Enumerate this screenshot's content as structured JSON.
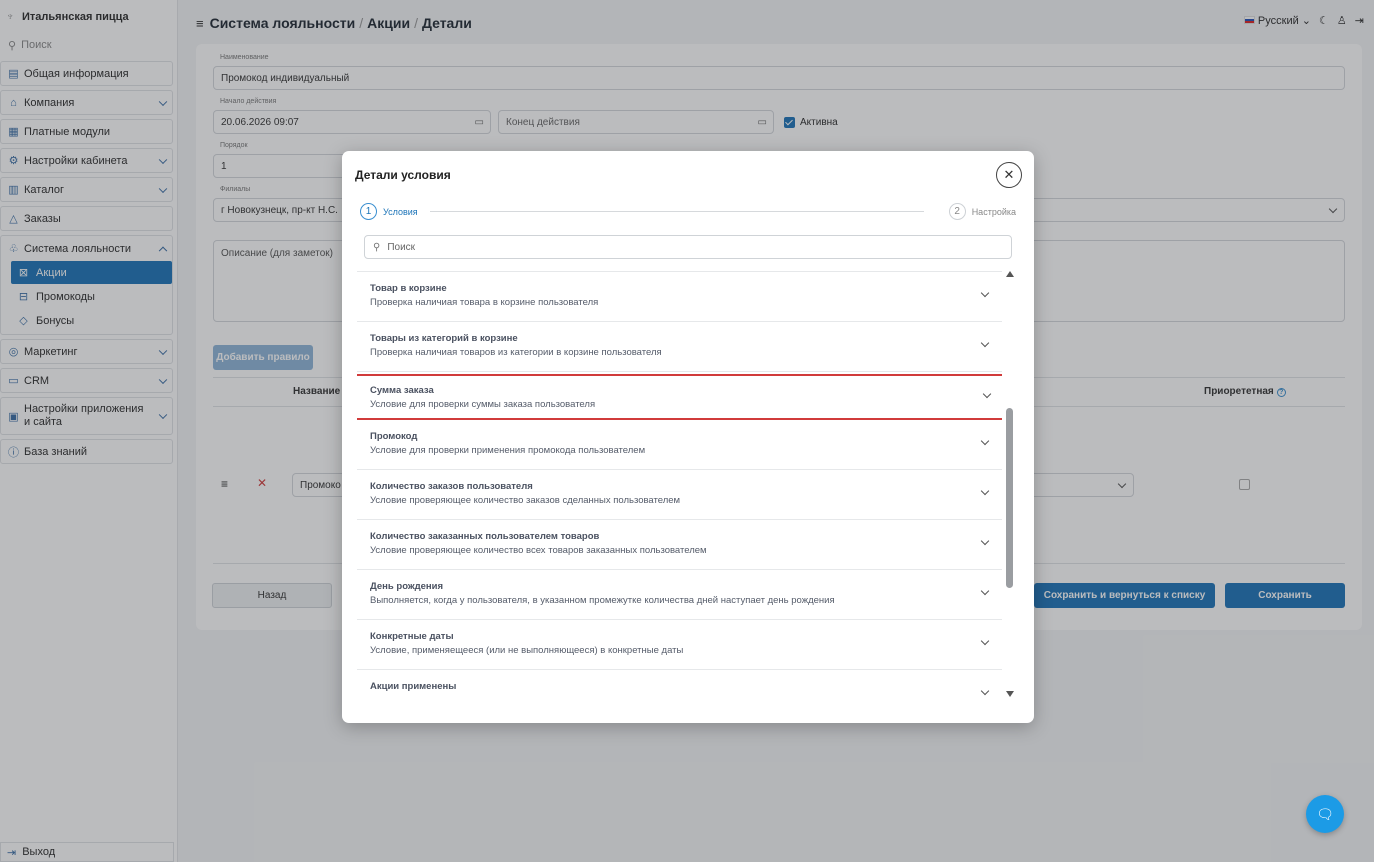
{
  "sidebar": {
    "brand": "Итальянская пицца",
    "search_label": "Поиск",
    "items": [
      {
        "label": "Общая информация",
        "icon": "doc-icon"
      },
      {
        "label": "Компания",
        "icon": "bank-icon"
      },
      {
        "label": "Платные модули",
        "icon": "modules-icon"
      },
      {
        "label": "Настройки кабинета",
        "icon": "settings-icon"
      },
      {
        "label": "Каталог",
        "icon": "catalog-icon"
      },
      {
        "label": "Заказы",
        "icon": "orders-icon"
      },
      {
        "label": "Система лояльности",
        "icon": "loyalty-icon"
      },
      {
        "label": "Маркетинг",
        "icon": "marketing-icon"
      },
      {
        "label": "CRM",
        "icon": "crm-icon"
      },
      {
        "label": "Настройки приложения и сайта",
        "icon": "app-icon"
      },
      {
        "label": "База знаний",
        "icon": "help-icon"
      }
    ],
    "loyalty_sub": [
      {
        "label": "Акции",
        "active": true
      },
      {
        "label": "Промокоды",
        "active": false
      },
      {
        "label": "Бонусы",
        "active": false
      }
    ],
    "logout_label": "Выход"
  },
  "header": {
    "crumb1": "Система лояльности",
    "crumb2": "Акции",
    "crumb3": "Детали",
    "sep": "/",
    "language": "Русский"
  },
  "form": {
    "name_label": "Наименование",
    "name_value": "Промокод индивидуальный",
    "start_label": "Начало действия",
    "start_value": "20.06.2026 09:07",
    "end_placeholder": "Конец действия",
    "active_label": "Активна",
    "order_label": "Порядок",
    "order_value": "1",
    "branches_label": "Филиалы",
    "branches_value": "г Новокузнецк, пр-кт Н.С.",
    "description_placeholder": "Описание (для заметок)",
    "add_rule_label": "Добавить правило",
    "col_name": "Название",
    "col_priority": "Приорететная",
    "row_value": "Промоко",
    "back_label": "Назад",
    "save_return_label": "Сохранить и вернуться к списку",
    "save_label": "Сохранить"
  },
  "modal": {
    "title": "Детали условия",
    "steps": [
      {
        "num": "1",
        "label": "Условия",
        "active": true
      },
      {
        "num": "2",
        "label": "Настройка",
        "active": false
      }
    ],
    "search_placeholder": "Поиск",
    "conditions": [
      {
        "title": "Товар в корзине",
        "desc": "Проверка наличиая товара в корзине пользователя"
      },
      {
        "title": "Товары из категорий в корзине",
        "desc": "Проверка наличиая товаров из категории в корзине пользователя"
      },
      {
        "title": "Сумма заказа",
        "desc": "Условие для проверки суммы заказа пользователя",
        "highlight": true
      },
      {
        "title": "Промокод",
        "desc": "Условие для проверки применения промокода пользователем"
      },
      {
        "title": "Количество заказов пользователя",
        "desc": "Условие проверяющее количество заказов сделанных пользователем"
      },
      {
        "title": "Количество заказанных пользователем товаров",
        "desc": "Условие проверяющее количество всех товаров заказанных пользователем"
      },
      {
        "title": "День рождения",
        "desc": "Выполняется, когда у пользователя, в указанном промежутке количества дней наступает день рождения"
      },
      {
        "title": "Конкретные даты",
        "desc": "Условие, применяещееся (или не выполняющееся) в конкретные даты"
      },
      {
        "title": "Акции применены",
        "desc": ""
      }
    ]
  },
  "colors": {
    "accent": "#1c74b8",
    "highlight": "#d13b3b",
    "chat": "#1c9be6"
  }
}
